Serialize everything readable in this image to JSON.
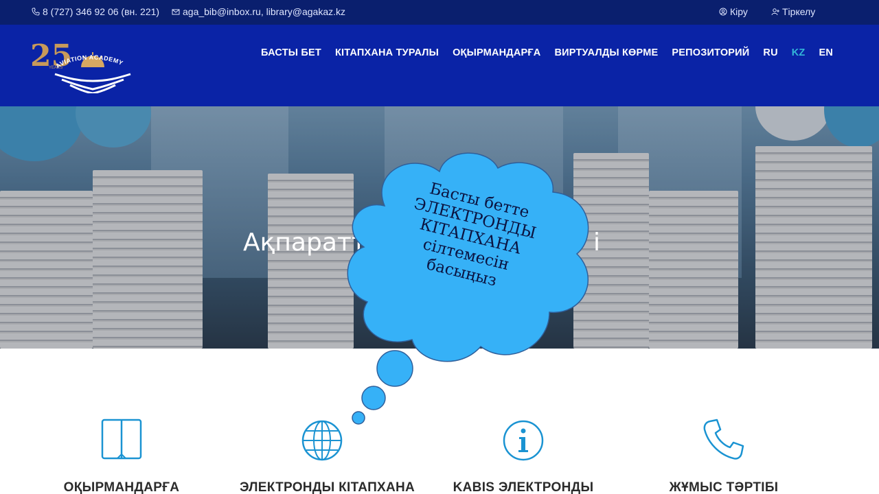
{
  "topbar": {
    "phone": "8 (727) 346 92 06 (вн. 221)",
    "email": "aga_bib@inbox.ru, library@agakaz.kz",
    "login": "Кіру",
    "register": "Тіркелу"
  },
  "logo": {
    "number": "25",
    "years": "YEARS",
    "arc_text": "AVIATION ACADEMY"
  },
  "nav": [
    {
      "label": "БАСТЫ БЕТ"
    },
    {
      "label": "КІТАПХАНА ТУРАЛЫ"
    },
    {
      "label": "ОҚЫРМАНДАРҒА"
    },
    {
      "label": "ВИРТУАЛДЫ КӨРМЕ"
    },
    {
      "label": "РЕПОЗИТОРИЙ"
    },
    {
      "label": "RU"
    },
    {
      "label": "KZ",
      "active": true
    },
    {
      "label": "EN"
    }
  ],
  "hero": {
    "title_left": "Ақпаратт",
    "title_right": "і"
  },
  "cloud": {
    "lines": [
      "Басты бетте",
      "ЭЛЕКТРОНДЫ",
      "КІТАПХАНА",
      "сілтемесін",
      "басыңыз"
    ]
  },
  "features": [
    {
      "label": "ОҚЫРМАНДАРҒА",
      "icon": "book-icon"
    },
    {
      "label": "ЭЛЕКТРОНДЫ КІТАПХАНА",
      "icon": "globe-icon"
    },
    {
      "label": "KABIS ЭЛЕКТРОНДЫ",
      "icon": "info-icon"
    },
    {
      "label": "ЖҰМЫС ТӘРТІБІ",
      "icon": "phone-icon"
    }
  ],
  "colors": {
    "topbar": "#0a1f6e",
    "header": "#0a23a6",
    "nav_active": "#33b6d8",
    "icon_accent": "#1a93d2",
    "cloud_fill": "#36b1f7",
    "cloud_stroke": "#2f5f9a"
  }
}
